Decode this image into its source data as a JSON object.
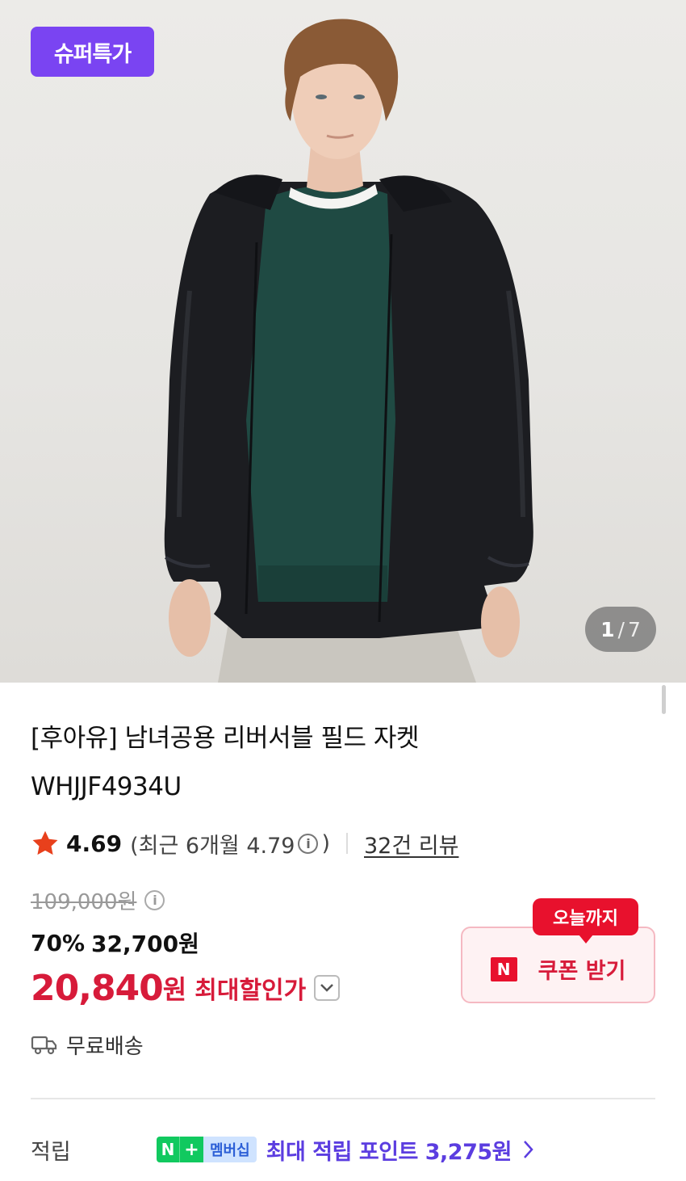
{
  "hero": {
    "badge": "슈퍼특가",
    "counter": {
      "current": "1",
      "separator": "/",
      "total": "7"
    }
  },
  "product": {
    "title_line1": "[후아유] 남녀공용 리버서블 필드 자켓",
    "title_line2": "WHJJF4934U",
    "rating": "4.69",
    "recent_rating_text": "(최근 6개월 4.79",
    "recent_rating_close": ")",
    "review_link": "32건 리뷰",
    "original_price": "109,000원",
    "sale_rate": "70%",
    "sale_price": "32,700원",
    "max_discount_price": "20,840",
    "max_discount_won": "원",
    "max_discount_label": "최대할인가",
    "shipping": "무료배송"
  },
  "coupon": {
    "tag": "오늘까지",
    "logo": "N",
    "label": "쿠폰 받기"
  },
  "points": {
    "label": "적립",
    "membership_n": "N",
    "membership_plus": "+",
    "membership_text": "멤버십",
    "text": "최대 적립 포인트 3,275원"
  },
  "colors": {
    "badge": "#7a44f2",
    "discount_red": "#d71b3a",
    "coupon_red": "#e8112d",
    "points_purple": "#5b3de0",
    "membership_green": "#11c95f"
  }
}
